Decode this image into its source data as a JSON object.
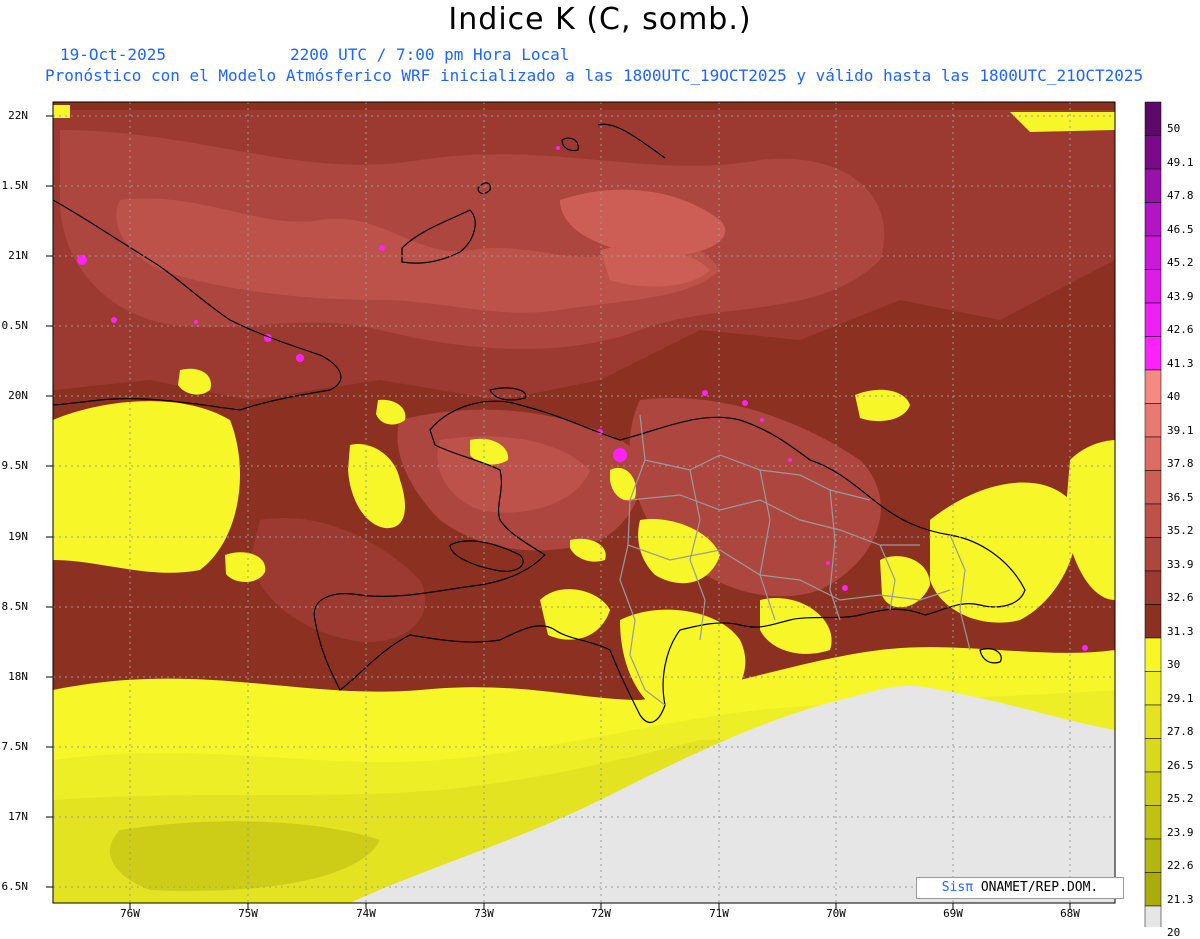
{
  "header": {
    "title": "Indice K (C, somb.)",
    "date": "19-Oct-2025",
    "time": "2200 UTC / 7:00 pm Hora Local",
    "description": "Pronóstico con el Modelo Atmósferico WRF inicializado a las 1800UTC_19OCT2025 y válido hasta las  1800UTC_21OCT2025"
  },
  "axes": {
    "lat_labels": [
      "22N",
      "1.5N",
      "21N",
      "0.5N",
      "20N",
      "9.5N",
      "19N",
      "8.5N",
      "18N",
      "7.5N",
      "17N",
      "6.5N"
    ],
    "lon_labels": [
      "76W",
      "75W",
      "74W",
      "73W",
      "72W",
      "71W",
      "70W",
      "69W",
      "68W"
    ]
  },
  "colorbar": {
    "labels": [
      "50",
      "49.1",
      "47.8",
      "46.5",
      "45.2",
      "43.9",
      "42.6",
      "41.3",
      "40",
      "39.1",
      "37.8",
      "36.5",
      "35.2",
      "33.9",
      "32.6",
      "31.3",
      "30",
      "29.1",
      "27.8",
      "26.5",
      "25.2",
      "23.9",
      "22.6",
      "21.3",
      "20"
    ],
    "colors": [
      "#5c0a6a",
      "#7a0a8a",
      "#9a10aa",
      "#b414c4",
      "#cc18d8",
      "#de1ce8",
      "#ee20f4",
      "#fb22fb",
      "#f48a82",
      "#e87a72",
      "#dc6c64",
      "#cc5e56",
      "#bc524a",
      "#ac463e",
      "#9c3a32",
      "#8c3022",
      "#f6f629",
      "#eeee26",
      "#e3e322",
      "#d8d81d",
      "#cdcd18",
      "#c1c113",
      "#b5b50f",
      "#abab0c",
      "#e6e6e6"
    ]
  },
  "credit": {
    "logo": "Sisπ",
    "text": " ONAMET/REP.DOM."
  }
}
